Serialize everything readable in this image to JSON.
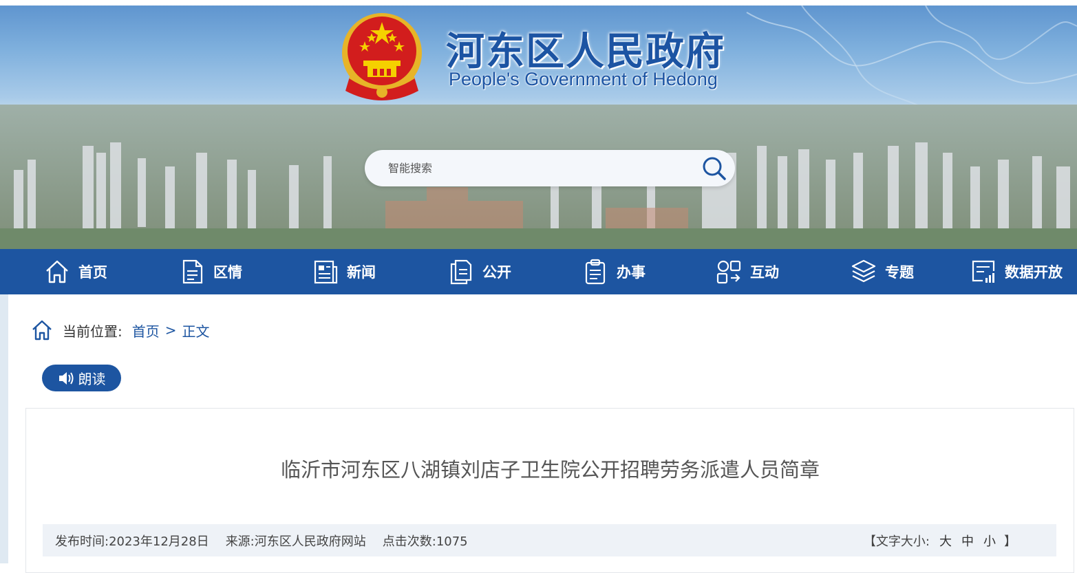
{
  "header": {
    "site_title": "河东区人民政府",
    "site_subtitle": "People's Government of Hedong",
    "search_placeholder": "智能搜索"
  },
  "nav": [
    {
      "label": "首页",
      "icon": "home-icon"
    },
    {
      "label": "区情",
      "icon": "document-icon"
    },
    {
      "label": "新闻",
      "icon": "news-icon"
    },
    {
      "label": "公开",
      "icon": "files-icon"
    },
    {
      "label": "办事",
      "icon": "clipboard-icon"
    },
    {
      "label": "互动",
      "icon": "interact-icon"
    },
    {
      "label": "专题",
      "icon": "layers-icon"
    },
    {
      "label": "数据开放",
      "icon": "data-chart-icon"
    }
  ],
  "breadcrumb": {
    "prefix": "当前位置:",
    "home": "首页",
    "separator": ">",
    "current": "正文"
  },
  "read_button": "朗读",
  "article": {
    "title": "临沂市河东区八湖镇刘店子卫生院公开招聘劳务派遣人员简章",
    "publish_time": "发布时间:2023年12月28日",
    "source": "来源:河东区人民政府网站",
    "views": "点击次数:1075",
    "font_size_label": "【文字大小:",
    "font_large": "大",
    "font_medium": "中",
    "font_small": "小",
    "font_size_end": "】"
  },
  "colors": {
    "brand_blue": "#1d55a1",
    "meta_bg": "#eef2f7"
  }
}
